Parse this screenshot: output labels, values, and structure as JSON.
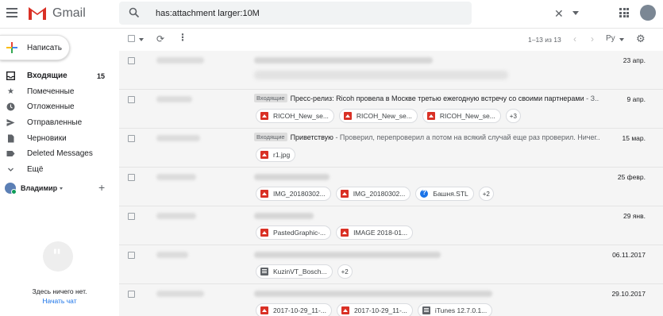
{
  "header": {
    "app_name": "Gmail",
    "search_value": "has:attachment larger:10M",
    "clear_symbol": "✕"
  },
  "sidebar": {
    "compose_label": "Написать",
    "items": [
      {
        "label": "Входящие",
        "icon": "inbox-icon",
        "count": "15",
        "active": true
      },
      {
        "label": "Помеченные",
        "icon": "star-icon"
      },
      {
        "label": "Отложенные",
        "icon": "clock-icon"
      },
      {
        "label": "Отправленные",
        "icon": "send-icon"
      },
      {
        "label": "Черновики",
        "icon": "draft-icon"
      },
      {
        "label": "Deleted Messages",
        "icon": "label-icon"
      },
      {
        "label": "Ещё",
        "icon": "chevron-down-icon"
      }
    ],
    "user_name": "Владимир",
    "hangouts_empty": "Здесь ничего нет.",
    "start_chat": "Начать чат"
  },
  "toolbar": {
    "range": "1–13 из 13",
    "lang": "Ру"
  },
  "rows": [
    {
      "date": "23 апр."
    },
    {
      "tag": "Входящие",
      "subject": "Пресс-релиз: Ricoh провела в Москве третью ежегодную встречу со своими партнерами",
      "snippet": " - З...",
      "date": "9 апр.",
      "attachments": [
        "RICOH_New_se...",
        "RICOH_New_se...",
        "RICOH_New_se..."
      ],
      "more": "+3"
    },
    {
      "tag": "Входящие",
      "subject": "Приветствую",
      "snippet": " - Проверил, перепроверил а потом на всякий случай еще раз проверил. Ничег...",
      "date": "15 мар.",
      "attachments": [
        "r1.jpg"
      ]
    },
    {
      "date": "25 февр.",
      "attachments": [
        "IMG_20180302...",
        "IMG_20180302...",
        "Башня.STL"
      ],
      "more": "+2"
    },
    {
      "date": "29 янв.",
      "attachments": [
        "PastedGraphic-...",
        "IMAGE 2018-01..."
      ]
    },
    {
      "date": "06.11.2017",
      "attachments": [
        "KuzinVT_Bosch..."
      ],
      "more": "+2"
    },
    {
      "date": "29.10.2017",
      "attachments": [
        "2017-10-29_11-...",
        "2017-10-29_11-...",
        "iTunes 12.7.0.1..."
      ]
    }
  ],
  "colors": {
    "accent": "#1a73e8",
    "gmail_red": "#d93025",
    "list_bg": "#f5f5f5"
  }
}
